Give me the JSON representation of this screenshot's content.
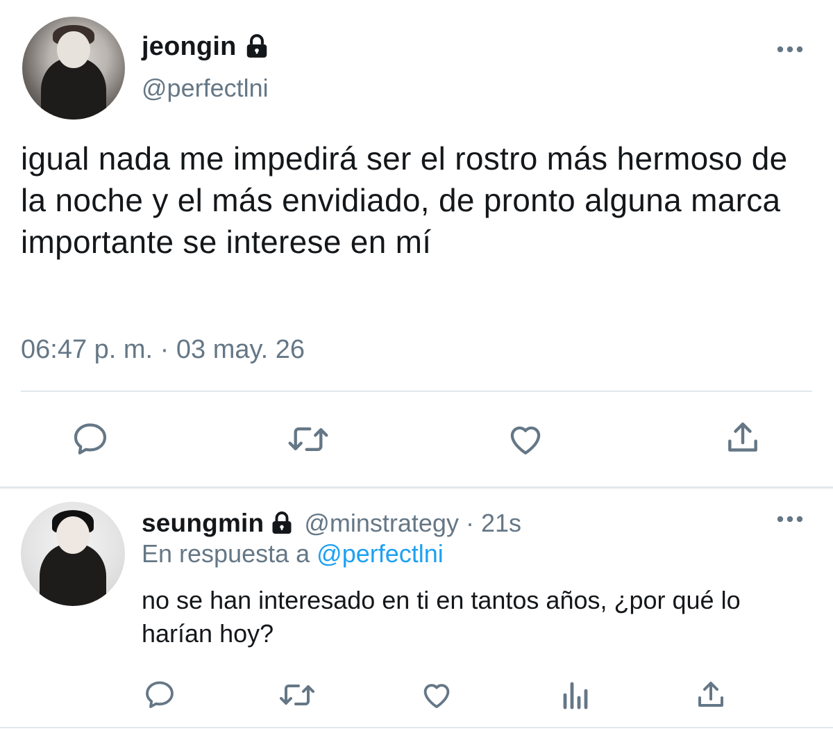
{
  "tweet": {
    "display_name": "jeongin",
    "handle": "@perfectlni",
    "text": "igual nada me impedirá ser el rostro más hermoso de la noche y el más envidiado, de pronto alguna marca importante se interese en mí",
    "time": "06:47 p. m. · 03 may. 26",
    "actions": [
      "reply-icon",
      "retweet-icon",
      "like-icon",
      "share-icon"
    ]
  },
  "reply": {
    "display_name": "seungmin",
    "handle": "@minstrategy",
    "separator": "·",
    "time": "21s",
    "in_reply_prefix": "En respuesta a",
    "in_reply_handle": "@perfectlni",
    "text": "no se han interesado en ti en tantos años, ¿por qué lo harían hoy?",
    "actions": [
      "reply-icon",
      "retweet-icon",
      "like-icon",
      "analytics-icon",
      "share-icon"
    ]
  },
  "colors": {
    "text": "#14171a",
    "muted": "#657786",
    "link": "#1da1f2",
    "divider": "#e1e8ed"
  }
}
